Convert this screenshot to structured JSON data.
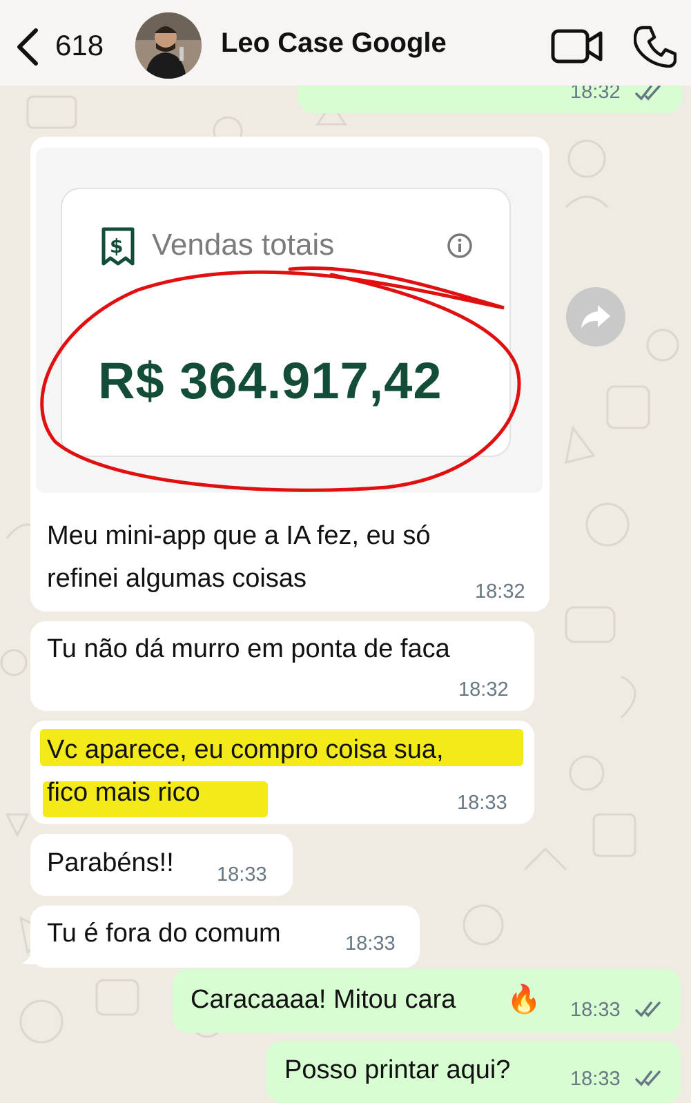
{
  "header": {
    "back_count": "618",
    "contact_name": "Leo Case Google"
  },
  "messages": {
    "prev_out_time": "18:32",
    "card_title": "Vendas totais",
    "card_value": "R$ 364.917,42",
    "msg1_line1": "Meu mini-app que a IA fez, eu só",
    "msg1_line2": "refinei algumas coisas",
    "msg1_time": "18:32",
    "msg2_text": "Tu não dá murro em ponta de faca",
    "msg2_time": "18:32",
    "msg3_line1": "Vc aparece, eu compro coisa sua,",
    "msg3_line2": "fico mais rico",
    "msg3_time": "18:33",
    "msg4_text": "Parabéns!!",
    "msg4_time": "18:33",
    "msg5_text": "Tu é fora do comum",
    "msg5_time": "18:33",
    "msg6_text": "Caracaaaa! Mitou cara",
    "msg6_emoji": "🔥",
    "msg6_time": "18:33",
    "msg7_text": "Posso printar aqui?",
    "msg7_time": "18:33"
  },
  "colors": {
    "incoming_bubble": "#ffffff",
    "outgoing_bubble": "#d9fdd3",
    "value_green": "#134d37",
    "annotation_red": "#e11010",
    "highlight_yellow": "#f4ea1a"
  },
  "icons": [
    "chevron-left-icon",
    "video-camera-icon",
    "phone-icon",
    "receipt-dollar-icon",
    "info-icon",
    "forward-icon",
    "double-check-icon",
    "fire-emoji"
  ]
}
